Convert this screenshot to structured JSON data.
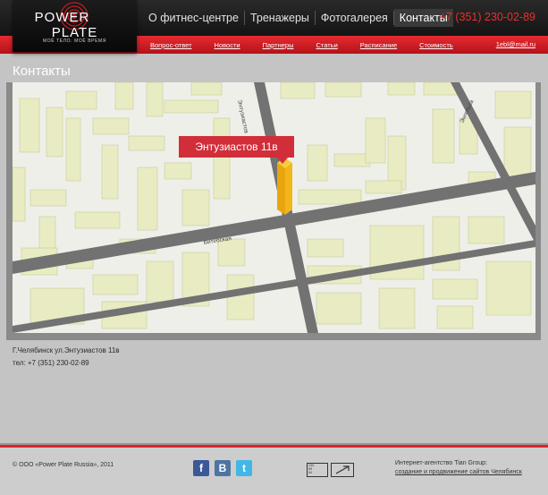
{
  "header": {
    "logo_text_left": "POWER",
    "logo_text_right": "PLATE",
    "logo_tagline": "МОЁ ТЕЛО. МОЁ ВРЕМЯ",
    "nav": [
      {
        "label": "О фитнес-центре"
      },
      {
        "label": "Тренажеры"
      },
      {
        "label": "Фотогалерея"
      },
      {
        "label": "Контакты",
        "active": true
      }
    ],
    "phone": "+7 (351) 230-02-89"
  },
  "subnav": {
    "links": [
      "Вопрос-ответ",
      "Новости",
      "Партнеры",
      "Статьи",
      "Расписание",
      "Стоимость"
    ],
    "email": "1ebl@mail.ru"
  },
  "main": {
    "title": "Контакты",
    "map": {
      "label": "Энтузиастов 11в",
      "streets": [
        "Энтузиастов",
        "Витебская",
        "Энгельса"
      ]
    },
    "address": "Г.Челябинск ул.Энтузиастов 11в",
    "phone_line": "тел: +7 (351) 230-02-89"
  },
  "footer": {
    "copyright": "© ООО «Power Plate Russia», 2011",
    "social": [
      "f",
      "B",
      "t"
    ],
    "counter_lines": [
      "239",
      "80",
      "84"
    ],
    "agency_line1": "Интернет-агентство Tian Group:",
    "agency_line2": "создание и продвижение сайтов Челябинск"
  },
  "colors": {
    "accent_red": "#d9242b",
    "header_dark": "#1a1a1a",
    "map_building": "#e9ecc2",
    "map_road": "#6f6f6f",
    "marker": "#f2b51a",
    "facebook": "#3b5998",
    "vk": "#4c75a3",
    "twitter": "#41b7e6"
  },
  "icons": {
    "facebook": "facebook-icon",
    "vk": "vk-icon",
    "twitter": "twitter-icon",
    "marker": "map-marker-icon"
  }
}
